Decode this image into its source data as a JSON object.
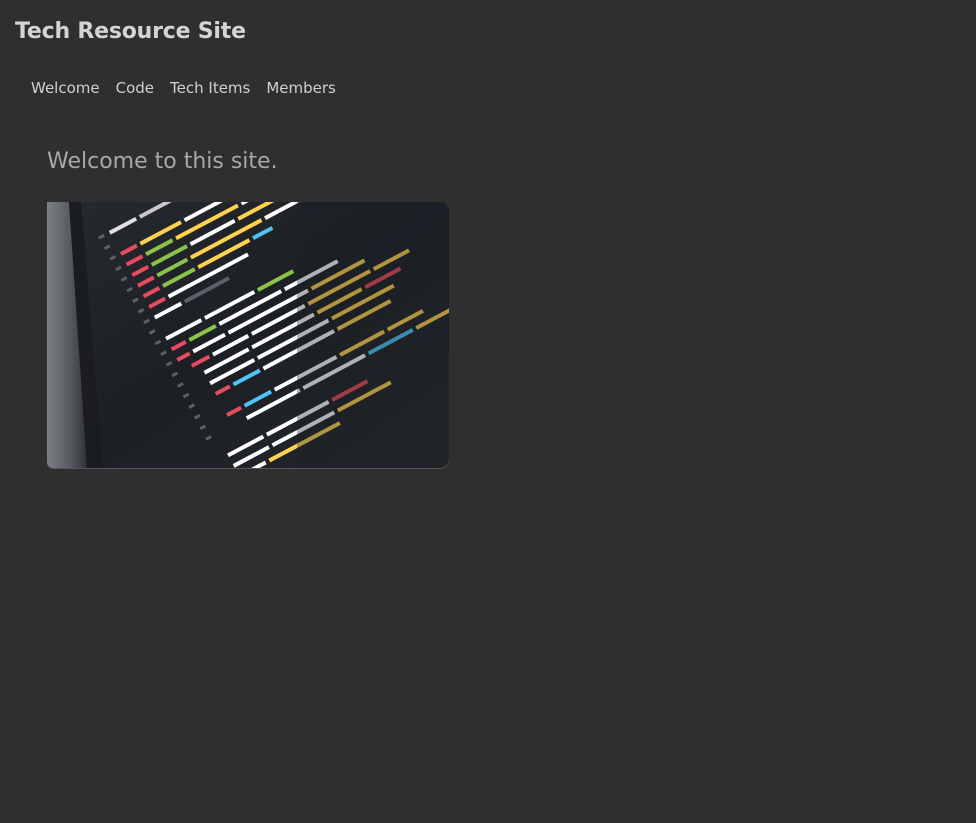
{
  "header": {
    "title": "Tech Resource Site"
  },
  "nav": {
    "items": [
      {
        "label": "Welcome"
      },
      {
        "label": "Code"
      },
      {
        "label": "Tech Items"
      },
      {
        "label": "Members"
      }
    ]
  },
  "main": {
    "heading": "Welcome to this site.",
    "hero_image": {
      "description_icon": "code-editor-photo"
    }
  },
  "colors": {
    "background": "#2f2f2f",
    "title": "#d4d4d4",
    "nav_text": "#d0d0d0",
    "heading": "#a8a8a8"
  }
}
